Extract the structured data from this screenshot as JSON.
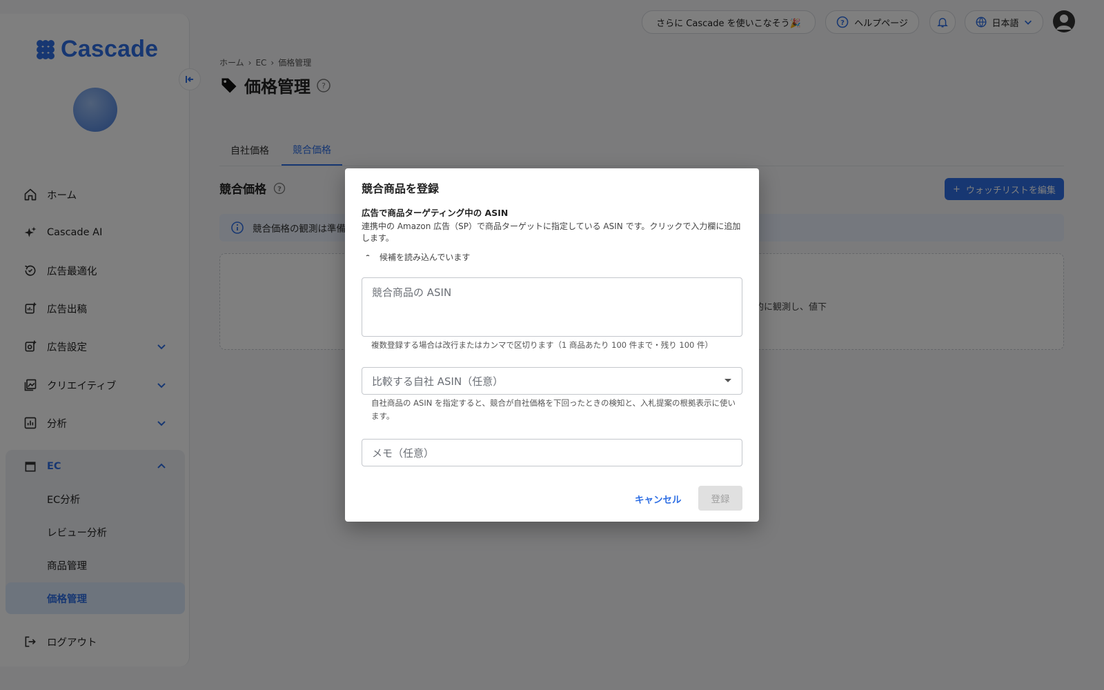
{
  "app": {
    "name": "Cascade"
  },
  "topbar": {
    "promo_label": "さらに Cascade を使いこなそう🎉",
    "help_label": "ヘルプページ",
    "language_label": "日本語"
  },
  "sidebar": {
    "items": [
      {
        "label": "ホーム",
        "icon": "home-icon"
      },
      {
        "label": "Cascade AI",
        "icon": "sparkle-icon"
      },
      {
        "label": "広告最適化",
        "icon": "optimize-icon"
      },
      {
        "label": "広告出稿",
        "icon": "ad-publish-icon"
      },
      {
        "label": "広告設定",
        "icon": "ad-settings-icon"
      },
      {
        "label": "クリエイティブ",
        "icon": "creative-icon"
      },
      {
        "label": "分析",
        "icon": "analytics-icon"
      },
      {
        "label": "EC",
        "icon": "store-icon"
      }
    ],
    "ec_subitems": [
      "EC分析",
      "レビュー分析",
      "商品管理",
      "価格管理"
    ],
    "logout_label": "ログアウト"
  },
  "breadcrumb": [
    "ホーム",
    "EC",
    "価格管理"
  ],
  "page": {
    "title": "価格管理",
    "tabs": [
      "自社価格",
      "競合価格"
    ],
    "active_tab": "競合価格",
    "section_title": "競合価格",
    "watchlist_button": "ウォッチリストを編集",
    "info_text": "競合価格の観測は準備",
    "empty_text": "的に観測し、値下"
  },
  "dialog": {
    "title": "競合商品を登録",
    "subtitle": "広告で商品ターゲティング中の ASIN",
    "description": "連携中の Amazon 広告（SP）で商品ターゲットに指定している ASIN です。クリックで入力欄に追加します。",
    "loading_text": "候補を読み込んでいます",
    "asin_placeholder": "競合商品の ASIN",
    "asin_helper": "複数登録する場合は改行またはカンマで区切ります（1 商品あたり 100 件まで・残り 100 件）",
    "own_asin_placeholder": "比較する自社 ASIN（任意）",
    "own_asin_helper": "自社商品の ASIN を指定すると、競合が自社価格を下回ったときの検知と、入札提案の根拠表示に使います。",
    "memo_placeholder": "メモ（任意）",
    "cancel_label": "キャンセル",
    "submit_label": "登録"
  },
  "colors": {
    "accent": "#2f6fe4",
    "overlay": "rgba(0,0,0,0.5)"
  }
}
